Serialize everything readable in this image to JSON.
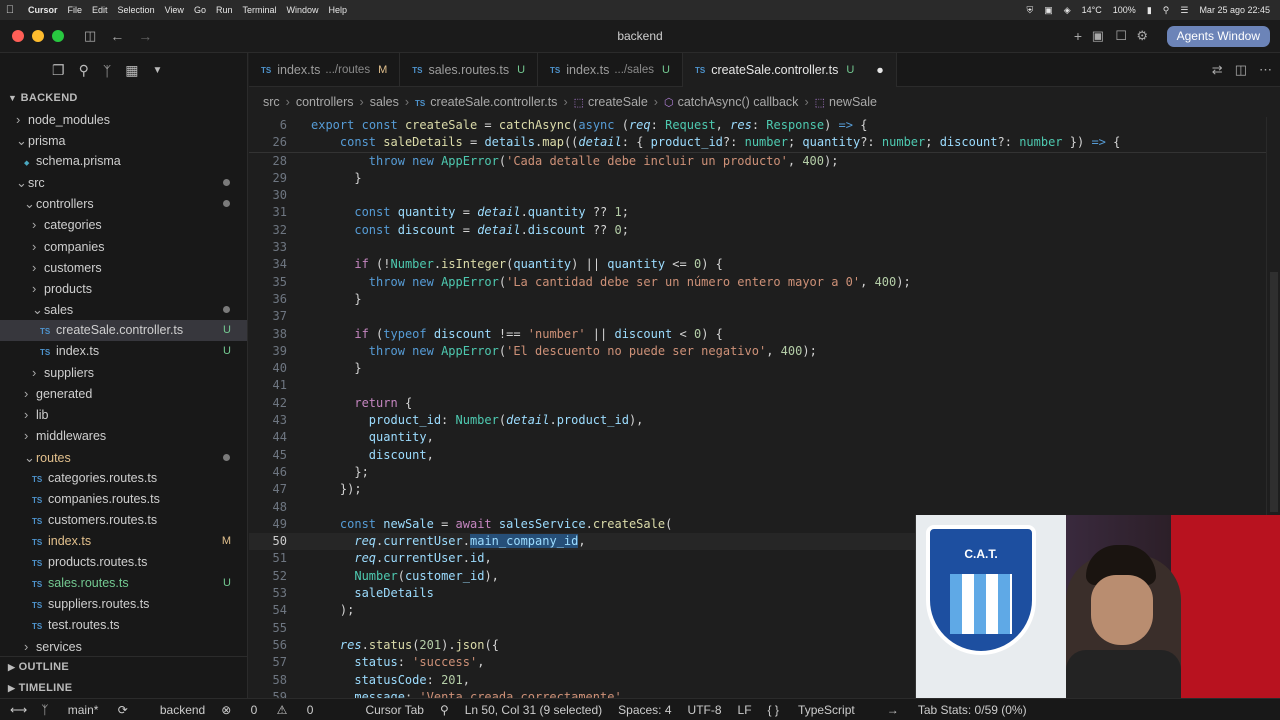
{
  "menubar": {
    "app": "Cursor",
    "items": [
      "File",
      "Edit",
      "Selection",
      "View",
      "Go",
      "Run",
      "Terminal",
      "Window",
      "Help"
    ],
    "temperature": "14°C",
    "battery": "100%",
    "datetime": "Mar 25 ago  22:45"
  },
  "window": {
    "title": "backend",
    "agents_button": "Agents Window"
  },
  "sidebar": {
    "root": "BACKEND",
    "tree": [
      {
        "label": "node_modules",
        "depth": 1,
        "kind": "folder",
        "open": false
      },
      {
        "label": "prisma",
        "depth": 1,
        "kind": "folder",
        "open": true
      },
      {
        "label": "schema.prisma",
        "depth": 2,
        "kind": "file"
      },
      {
        "label": "src",
        "depth": 1,
        "kind": "folder",
        "open": true,
        "dot": true
      },
      {
        "label": "controllers",
        "depth": 2,
        "kind": "folder",
        "open": true,
        "dot": true
      },
      {
        "label": "categories",
        "depth": 3,
        "kind": "folder",
        "open": false
      },
      {
        "label": "companies",
        "depth": 3,
        "kind": "folder",
        "open": false
      },
      {
        "label": "customers",
        "depth": 3,
        "kind": "folder",
        "open": false
      },
      {
        "label": "products",
        "depth": 3,
        "kind": "folder",
        "open": false
      },
      {
        "label": "sales",
        "depth": 3,
        "kind": "folder",
        "open": true,
        "dot": true
      },
      {
        "label": "createSale.controller.ts",
        "depth": 4,
        "kind": "ts",
        "badge": "U",
        "selected": true
      },
      {
        "label": "index.ts",
        "depth": 4,
        "kind": "ts",
        "badge": "U"
      },
      {
        "label": "suppliers",
        "depth": 3,
        "kind": "folder",
        "open": false
      },
      {
        "label": "generated",
        "depth": 2,
        "kind": "folder",
        "open": false
      },
      {
        "label": "lib",
        "depth": 2,
        "kind": "folder",
        "open": false
      },
      {
        "label": "middlewares",
        "depth": 2,
        "kind": "folder",
        "open": false
      },
      {
        "label": "routes",
        "depth": 2,
        "kind": "folder",
        "open": true,
        "dot": true,
        "color": "orange"
      },
      {
        "label": "categories.routes.ts",
        "depth": 3,
        "kind": "ts"
      },
      {
        "label": "companies.routes.ts",
        "depth": 3,
        "kind": "ts"
      },
      {
        "label": "customers.routes.ts",
        "depth": 3,
        "kind": "ts"
      },
      {
        "label": "index.ts",
        "depth": 3,
        "kind": "ts",
        "badge": "M",
        "color": "orange"
      },
      {
        "label": "products.routes.ts",
        "depth": 3,
        "kind": "ts"
      },
      {
        "label": "sales.routes.ts",
        "depth": 3,
        "kind": "ts",
        "badge": "U",
        "color": "green"
      },
      {
        "label": "suppliers.routes.ts",
        "depth": 3,
        "kind": "ts"
      },
      {
        "label": "test.routes.ts",
        "depth": 3,
        "kind": "ts"
      },
      {
        "label": "services",
        "depth": 2,
        "kind": "folder",
        "open": false
      }
    ],
    "outline": "OUTLINE",
    "timeline": "TIMELINE"
  },
  "tabs": [
    {
      "name": "index.ts",
      "desc": ".../routes",
      "status": "M",
      "color": "orange"
    },
    {
      "name": "sales.routes.ts",
      "desc": "",
      "status": "U",
      "color": "green"
    },
    {
      "name": "index.ts",
      "desc": ".../sales",
      "status": "U",
      "color": "green"
    },
    {
      "name": "createSale.controller.ts",
      "desc": "",
      "status": "U",
      "color": "green",
      "active": true
    }
  ],
  "breadcrumbs": [
    "src",
    "controllers",
    "sales",
    "createSale.controller.ts",
    "createSale",
    "catchAsync() callback",
    "newSale"
  ],
  "code": {
    "sticky": [
      {
        "n": "6",
        "html": "<span class='kw'>export</span> <span class='kw'>const</span> <span class='fn'>createSale</span> = <span class='fn'>catchAsync</span>(<span class='kw'>async</span> (<span class='vr it'>req</span>: <span class='ty'>Request</span>, <span class='vr it'>res</span>: <span class='ty'>Response</span>) <span class='kw'>=&gt;</span> {"
      },
      {
        "n": "26",
        "html": "    <span class='kw'>const</span> <span class='fn'>saleDetails</span> = <span class='vr'>details</span>.<span class='fn'>map</span>((<span class='vr it'>detail</span>: { <span class='vr'>product_id</span>?: <span class='ty'>number</span>; <span class='vr'>quantity</span>?: <span class='ty'>number</span>; <span class='vr'>discount</span>?: <span class='ty'>number</span> }) <span class='kw'>=&gt;</span> {"
      }
    ],
    "lines": [
      {
        "n": "28",
        "html": "        <span class='kw'>throw</span> <span class='kw'>new</span> <span class='ty'>AppError</span>(<span class='st2'>'Cada detalle debe incluir un producto'</span>, <span class='nm'>400</span>);"
      },
      {
        "n": "29",
        "html": "      }"
      },
      {
        "n": "30",
        "html": ""
      },
      {
        "n": "31",
        "html": "      <span class='kw'>const</span> <span class='vr'>quantity</span> = <span class='vr it'>detail</span>.<span class='vr'>quantity</span> ?? <span class='nm'>1</span>;"
      },
      {
        "n": "32",
        "html": "      <span class='kw'>const</span> <span class='vr'>discount</span> = <span class='vr it'>detail</span>.<span class='vr'>discount</span> ?? <span class='nm'>0</span>;"
      },
      {
        "n": "33",
        "html": ""
      },
      {
        "n": "34",
        "html": "      <span class='ct'>if</span> (!<span class='ty'>Number</span>.<span class='fn'>isInteger</span>(<span class='vr'>quantity</span>) || <span class='vr'>quantity</span> &lt;= <span class='nm'>0</span>) {"
      },
      {
        "n": "35",
        "html": "        <span class='kw'>throw</span> <span class='kw'>new</span> <span class='ty'>AppError</span>(<span class='st2'>'La cantidad debe ser un número entero mayor a 0'</span>, <span class='nm'>400</span>);"
      },
      {
        "n": "36",
        "html": "      }"
      },
      {
        "n": "37",
        "html": ""
      },
      {
        "n": "38",
        "html": "      <span class='ct'>if</span> (<span class='kw'>typeof</span> <span class='vr'>discount</span> !== <span class='st2'>'number'</span> || <span class='vr'>discount</span> &lt; <span class='nm'>0</span>) {"
      },
      {
        "n": "39",
        "html": "        <span class='kw'>throw</span> <span class='kw'>new</span> <span class='ty'>AppError</span>(<span class='st2'>'El descuento no puede ser negativo'</span>, <span class='nm'>400</span>);"
      },
      {
        "n": "40",
        "html": "      }"
      },
      {
        "n": "41",
        "html": ""
      },
      {
        "n": "42",
        "html": "      <span class='ct'>return</span> {"
      },
      {
        "n": "43",
        "html": "        <span class='vr'>product_id</span>: <span class='ty'>Number</span>(<span class='vr it'>detail</span>.<span class='vr'>product_id</span>),"
      },
      {
        "n": "44",
        "html": "        <span class='vr'>quantity</span>,"
      },
      {
        "n": "45",
        "html": "        <span class='vr'>discount</span>,"
      },
      {
        "n": "46",
        "html": "      };"
      },
      {
        "n": "47",
        "html": "    });"
      },
      {
        "n": "48",
        "html": ""
      },
      {
        "n": "49",
        "html": "    <span class='kw'>const</span> <span class='vr'>newSale</span> = <span class='ct'>await</span> <span class='vr'>salesService</span>.<span class='fn'>createSale</span>("
      },
      {
        "n": "50",
        "cur": true,
        "html": "      <span class='vr it'>req</span>.<span class='vr'>currentUser</span>.<span class='vr selbg'>main_company_id</span>,"
      },
      {
        "n": "51",
        "html": "      <span class='vr it'>req</span>.<span class='vr'>currentUser</span>.<span class='vr'>id</span>,"
      },
      {
        "n": "52",
        "html": "      <span class='ty'>Number</span>(<span class='vr'>customer_id</span>),"
      },
      {
        "n": "53",
        "html": "      <span class='vr'>saleDetails</span>"
      },
      {
        "n": "54",
        "html": "    );"
      },
      {
        "n": "55",
        "html": ""
      },
      {
        "n": "56",
        "html": "    <span class='vr it'>res</span>.<span class='fn'>status</span>(<span class='nm'>201</span>).<span class='fn'>json</span>({"
      },
      {
        "n": "57",
        "html": "      <span class='vr'>status</span>: <span class='st2'>'success'</span>,"
      },
      {
        "n": "58",
        "html": "      <span class='vr'>statusCode</span>: <span class='nm'>201</span>,"
      },
      {
        "n": "59",
        "html": "      <span class='vr'>message</span>: <span class='st2'>'Venta creada correctamente'</span>,"
      }
    ]
  },
  "statusbar": {
    "branch": "main*",
    "project": "backend",
    "problems": "0",
    "warnings": "0",
    "cursor_tab": "Cursor Tab",
    "position": "Ln 50, Col 31 (9 selected)",
    "spaces": "Spaces: 4",
    "encoding": "UTF-8",
    "eol": "LF",
    "language": "TypeScript",
    "tabstats": "Tab Stats: 0/59 (0%)"
  },
  "webcam": {
    "label": "C.A.T."
  }
}
